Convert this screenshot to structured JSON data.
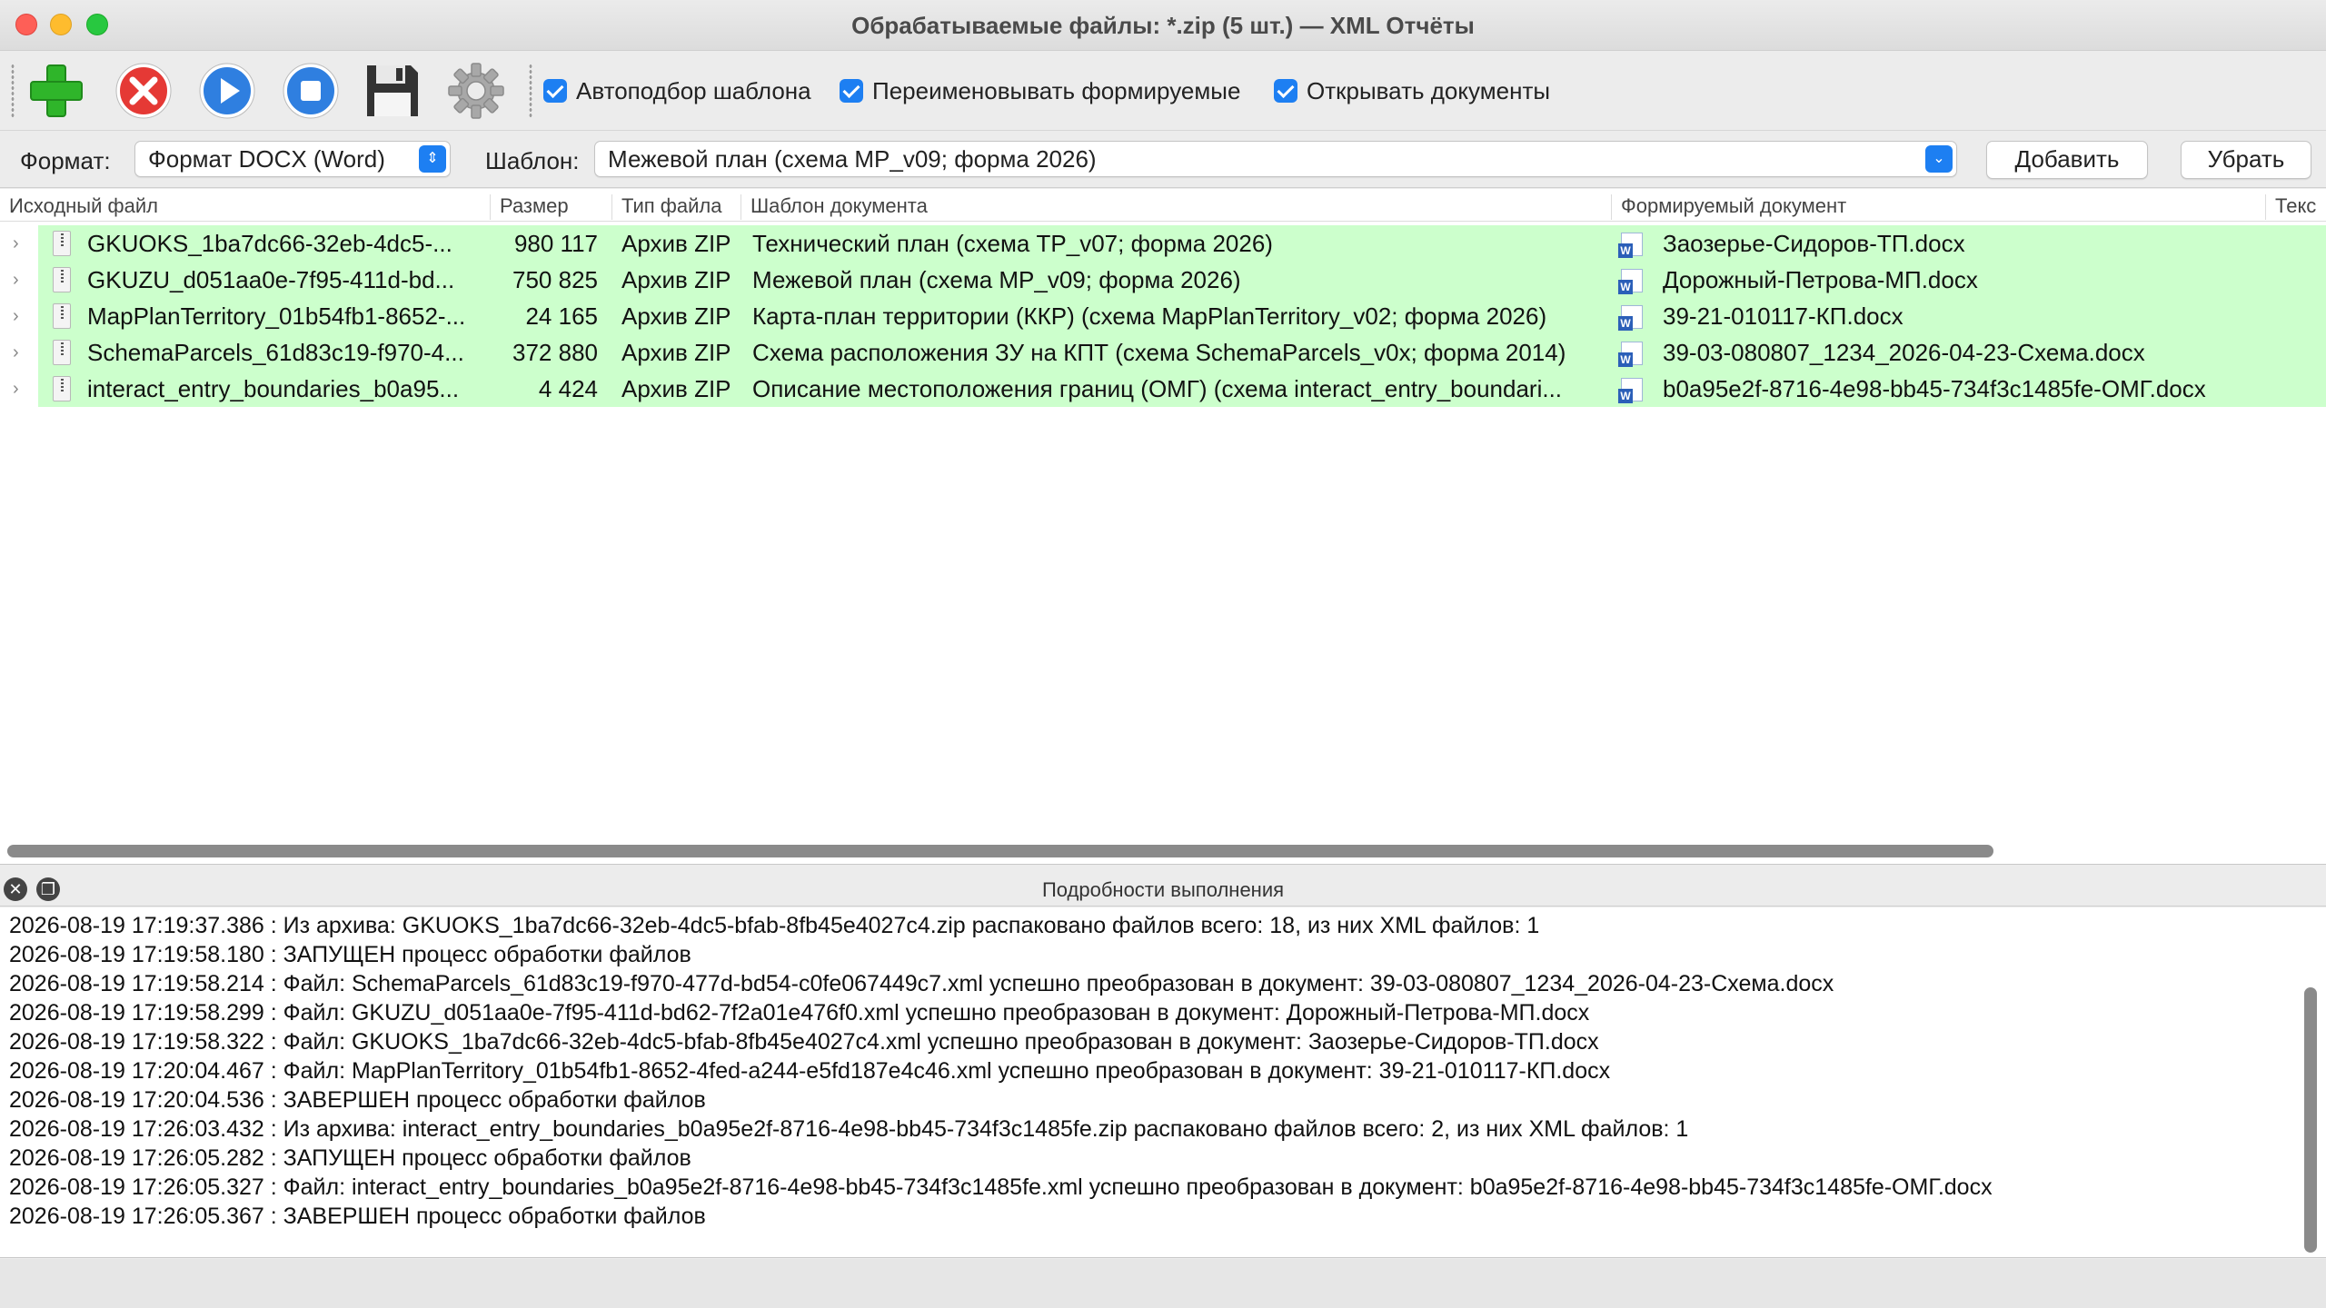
{
  "window": {
    "title": "Обрабатываемые файлы: *.zip (5 шт.) — XML Отчёты"
  },
  "toolbar": {
    "buttons": [
      {
        "name": "add-icon",
        "color": "#2fb52a"
      },
      {
        "name": "delete-icon",
        "color": "#e53935"
      },
      {
        "name": "play-icon",
        "color": "#2f7fe0"
      },
      {
        "name": "stop-icon",
        "color": "#2f7fe0"
      },
      {
        "name": "save-icon",
        "color": "#333333"
      },
      {
        "name": "gear-icon",
        "color": "#999999"
      }
    ],
    "checkboxes": [
      {
        "label": "Автоподбор шаблона",
        "checked": true
      },
      {
        "label": "Переименовывать формируемые",
        "checked": true
      },
      {
        "label": "Открывать документы",
        "checked": true
      }
    ]
  },
  "format_row": {
    "format_label": "Формат:",
    "format_value": "Формат DOCX (Word)",
    "template_label": "Шаблон:",
    "template_value": "Межевой план (схема MP_v09; форма 2026)",
    "add_button": "Добавить",
    "remove_button": "Убрать"
  },
  "table": {
    "columns": [
      "Исходный файл",
      "Размер",
      "Тип файла",
      "Шаблон документа",
      "Формируемый документ",
      "Текс"
    ],
    "row_color": "#ccffcc",
    "rows": [
      {
        "file": "GKUOKS_1ba7dc66-32eb-4dc5-...",
        "size": "980 117",
        "type": "Архив ZIP",
        "template": "Технический план (схема TP_v07; форма 2026)",
        "output": "Заозерье-Сидоров-ТП.docx"
      },
      {
        "file": "GKUZU_d051aa0e-7f95-411d-bd...",
        "size": "750 825",
        "type": "Архив ZIP",
        "template": "Межевой план (схема MP_v09; форма 2026)",
        "output": "Дорожный-Петрова-МП.docx"
      },
      {
        "file": "MapPlanTerritory_01b54fb1-8652-...",
        "size": "24 165",
        "type": "Архив ZIP",
        "template": "Карта-план территории (ККР) (схема MapPlanTerritory_v02; форма 2026)",
        "output": "39-21-010117-КП.docx"
      },
      {
        "file": "SchemaParcels_61d83c19-f970-4...",
        "size": "372 880",
        "type": "Архив ZIP",
        "template": "Схема расположения ЗУ на КПТ (схема SchemaParcels_v0x; форма 2014)",
        "output": "39-03-080807_1234_2026-04-23-Схема.docx"
      },
      {
        "file": "interact_entry_boundaries_b0a95...",
        "size": "4 424",
        "type": "Архив ZIP",
        "template": "Описание местоположения границ (ОМГ) (схема interact_entry_boundari...",
        "output": "b0a95e2f-8716-4e98-bb45-734f3c1485fe-ОМГ.docx"
      }
    ]
  },
  "log": {
    "title": "Подробности выполнения",
    "lines": [
      "2026-08-19 17:19:37.386 : Из архива: GKUOKS_1ba7dc66-32eb-4dc5-bfab-8fb45e4027c4.zip распаковано файлов всего: 18, из них XML файлов: 1",
      "2026-08-19 17:19:58.180 : ЗАПУЩЕН процесс обработки файлов",
      "2026-08-19 17:19:58.214 : Файл: SchemaParcels_61d83c19-f970-477d-bd54-c0fe067449c7.xml успешно преобразован в документ: 39-03-080807_1234_2026-04-23-Схема.docx",
      "2026-08-19 17:19:58.299 : Файл: GKUZU_d051aa0e-7f95-411d-bd62-7f2a01e476f0.xml успешно преобразован в документ: Дорожный-Петрова-МП.docx",
      "2026-08-19 17:19:58.322 : Файл: GKUOKS_1ba7dc66-32eb-4dc5-bfab-8fb45e4027c4.xml успешно преобразован в документ: Заозерье-Сидоров-ТП.docx",
      "2026-08-19 17:20:04.467 : Файл: MapPlanTerritory_01b54fb1-8652-4fed-a244-e5fd187e4c46.xml успешно преобразован в документ: 39-21-010117-КП.docx",
      "2026-08-19 17:20:04.536 : ЗАВЕРШЕН процесс обработки файлов",
      "2026-08-19 17:26:03.432 : Из архива: interact_entry_boundaries_b0a95e2f-8716-4e98-bb45-734f3c1485fe.zip распаковано файлов всего: 2, из них XML файлов: 1",
      "2026-08-19 17:26:05.282 : ЗАПУЩЕН процесс обработки файлов",
      "2026-08-19 17:26:05.327 : Файл: interact_entry_boundaries_b0a95e2f-8716-4e98-bb45-734f3c1485fe.xml успешно преобразован в документ: b0a95e2f-8716-4e98-bb45-734f3c1485fe-ОМГ.docx",
      "2026-08-19 17:26:05.367 : ЗАВЕРШЕН процесс обработки файлов"
    ]
  }
}
